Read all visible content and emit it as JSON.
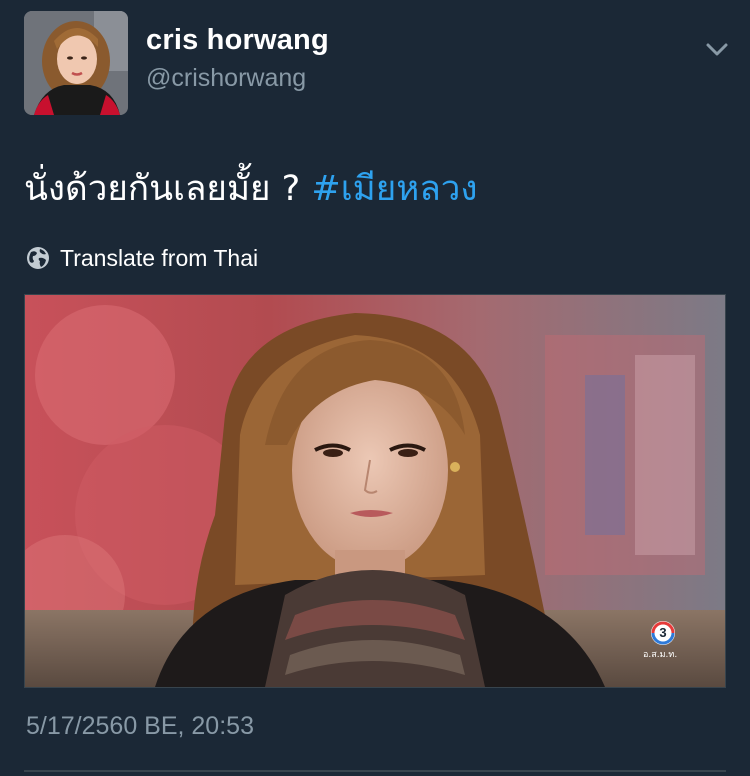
{
  "user": {
    "display_name": "cris horwang",
    "handle": "@crishorwang"
  },
  "tweet": {
    "text": "นั่งด้วยกันเลยมั้ย ?",
    "hashtag": "#เมียหลวง",
    "hashtag_color": "#2ea2ef"
  },
  "translate": {
    "label": "Translate from Thai",
    "icon": "globe-icon"
  },
  "media": {
    "channel_logo_text": "3",
    "channel_caption": "อ.ส.ม.ท."
  },
  "timestamp": "5/17/2560 BE, 20:53",
  "colors": {
    "background": "#1b2836",
    "secondary_text": "#8899a6",
    "accent": "#2ea2ef"
  },
  "icons": {
    "menu": "chevron-down-icon"
  }
}
